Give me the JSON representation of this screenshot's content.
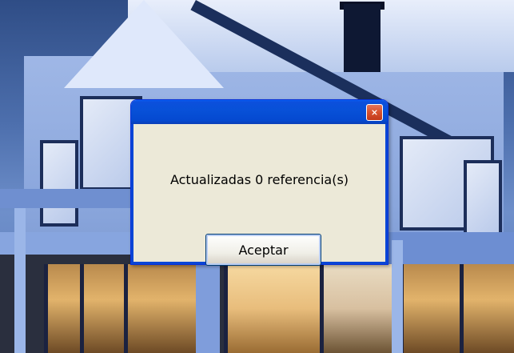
{
  "dialog": {
    "title": "",
    "message": "Actualizadas 0 referencia(s)",
    "ok_label": "Aceptar",
    "close_icon": "close-icon"
  },
  "colors": {
    "titlebar": "#0851d8",
    "dialog_body": "#ece9d8",
    "close_button": "#d9532f"
  }
}
